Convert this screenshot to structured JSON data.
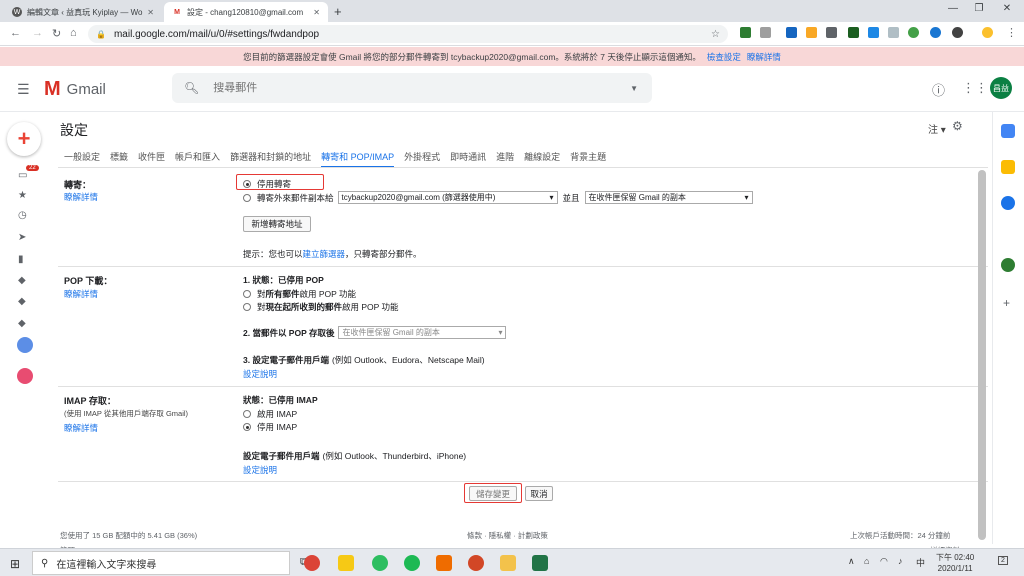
{
  "browser": {
    "tabs": [
      {
        "title": "編輯文章 ‹ 益真玩 Kyiplay — Wo",
        "icon": "wordpress-icon"
      },
      {
        "title": "設定 - chang120810@gmail.com",
        "icon": "gmail-icon"
      }
    ],
    "url": "mail.google.com/mail/u/0/#settings/fwdandpop"
  },
  "notice": {
    "text": "您目前的篩選器設定會使 Gmail 將您的部分郵件轉寄到 tcybackup2020@gmail.com。系統將於 7 天後停止顯示這個通知。",
    "link1": "檢查設定",
    "link2": "瞭解詳情"
  },
  "header": {
    "app_name": "Gmail",
    "search_placeholder": "搜尋郵件",
    "avatar_text": "昌益"
  },
  "rail": {
    "badge": "22"
  },
  "settings": {
    "title": "設定",
    "lang": "注",
    "tabs": [
      "一般設定",
      "標籤",
      "收件匣",
      "帳戶和匯入",
      "篩選器和封鎖的地址",
      "轉寄和 POP/IMAP",
      "外掛程式",
      "即時通訊",
      "進階",
      "離線設定",
      "背景主題"
    ],
    "active_tab": "轉寄和 POP/IMAP"
  },
  "forwarding": {
    "label": "轉寄：",
    "learn_more": "瞭解詳情",
    "option_disable": "停用轉寄",
    "option_forward": "轉寄外來郵件副本給",
    "forward_address": "tcybackup2020@gmail.com (篩選器使用中)",
    "and_text": "並且",
    "keep_option": "在收件匣保留 Gmail 的副本",
    "add_address_button": "新增轉寄地址",
    "tip_prefix": "提示：您也可以",
    "tip_link": "建立篩選器",
    "tip_suffix": "，只轉寄部分郵件。"
  },
  "pop": {
    "label": "POP 下載：",
    "learn_more": "瞭解詳情",
    "status_prefix": "1. 狀態：",
    "status_value": "已停用 POP",
    "option_all_pre": "對",
    "option_all_bold": "所有郵件",
    "option_all_post": "啟用 POP 功能",
    "option_now_pre": "對",
    "option_now_bold": "現在起所收到的郵件",
    "option_now_post": "啟用 POP 功能",
    "step2": "2. 當郵件以 POP 存取後",
    "step2_select": "在收件匣保留 Gmail 的副本",
    "step3_bold": "3. 設定電子郵件用戶端",
    "step3_rest": "(例如 Outlook、Eudora、Netscape Mail)",
    "config_link": "設定說明"
  },
  "imap": {
    "label": "IMAP 存取：",
    "sub": "(使用 IMAP 從其他用戶端存取 Gmail)",
    "learn_more": "瞭解詳情",
    "status": "狀態：已停用 IMAP",
    "option_enable": "啟用 IMAP",
    "option_disable": "停用 IMAP",
    "client_bold": "設定電子郵件用戶端",
    "client_rest": "(例如 Outlook、Thunderbird、iPhone)",
    "config_link": "設定說明"
  },
  "actions": {
    "save": "儲存變更",
    "cancel": "取消"
  },
  "footer": {
    "storage": "您使用了 15 GB 配額中的 5.41 GB (36%)",
    "manage": "管理",
    "terms": "條款 · 隱私權 · 計劃政策",
    "activity": "上次帳戶活動時間：24 分鐘前",
    "details": "詳細資料"
  },
  "taskbar": {
    "search_placeholder": "在這裡輸入文字來搜尋",
    "time": "下午 02:40",
    "date": "2020/1/11",
    "lang": "中",
    "notif": "2"
  },
  "colors": {
    "accent": "#1a73e8",
    "highlight_box": "#e53935",
    "notice_bg": "#f8d7d7"
  }
}
